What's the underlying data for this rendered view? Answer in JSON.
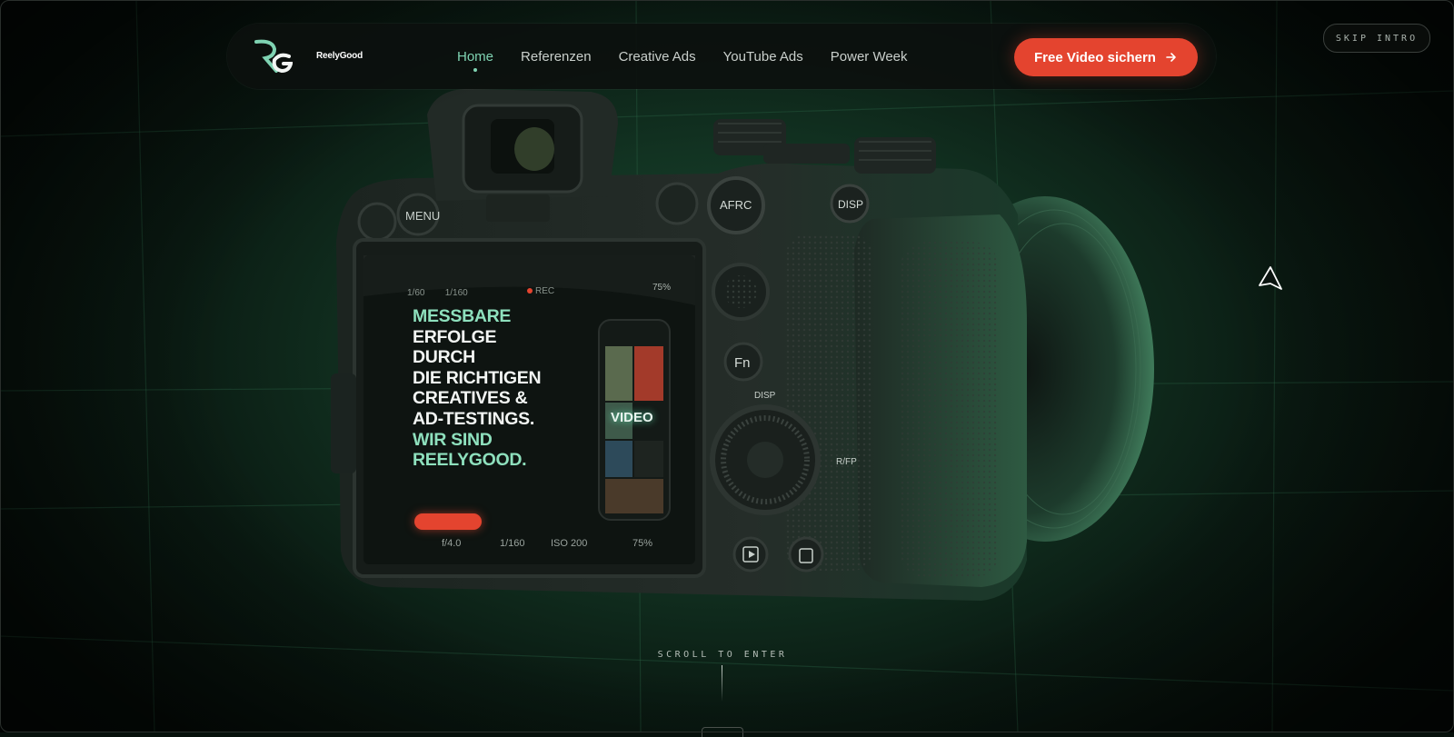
{
  "brand": {
    "name_part1": "Reely",
    "name_part2": "Good",
    "logo_letters": "RG",
    "accent": "#7fd3b2"
  },
  "nav": {
    "items": [
      {
        "label": "Home",
        "active": true
      },
      {
        "label": "Referenzen",
        "active": false
      },
      {
        "label": "Creative Ads",
        "active": false
      },
      {
        "label": "YouTube Ads",
        "active": false
      },
      {
        "label": "Power Week",
        "active": false
      }
    ],
    "cta_label": "Free Video sichern",
    "cta_icon": "arrow-right-icon",
    "cta_color": "#e4442f"
  },
  "skip_intro": {
    "label": "SKIP INTRO"
  },
  "camera_screen": {
    "top_left": "1/60",
    "top_shutter": "1/160",
    "rec": "REC",
    "battery": "75%",
    "headline_lines": [
      {
        "text": "MESSBARE",
        "color": "green"
      },
      {
        "text": "ERFOLGE",
        "color": "white"
      },
      {
        "text": "DURCH",
        "color": "white"
      },
      {
        "text": "DIE RICHTIGEN",
        "color": "white"
      },
      {
        "text": "CREATIVES &",
        "color": "white"
      },
      {
        "text": "AD-TESTINGS.",
        "color": "white"
      },
      {
        "text": "WIR SIND",
        "color": "green"
      },
      {
        "text": "REELYGOOD.",
        "color": "green"
      }
    ],
    "phone_label": "VIDEO",
    "bottom_stats": [
      "f/4.0",
      "1/160",
      "ISO 200",
      "75%"
    ]
  },
  "camera_buttons": {
    "menu": "MENU",
    "afrc": "AFRC",
    "disp": "DISP",
    "fn": "Fn",
    "disp2": "DISP",
    "rfp": "R/FP"
  },
  "scroll": {
    "label": "SCROLL TO ENTER"
  }
}
